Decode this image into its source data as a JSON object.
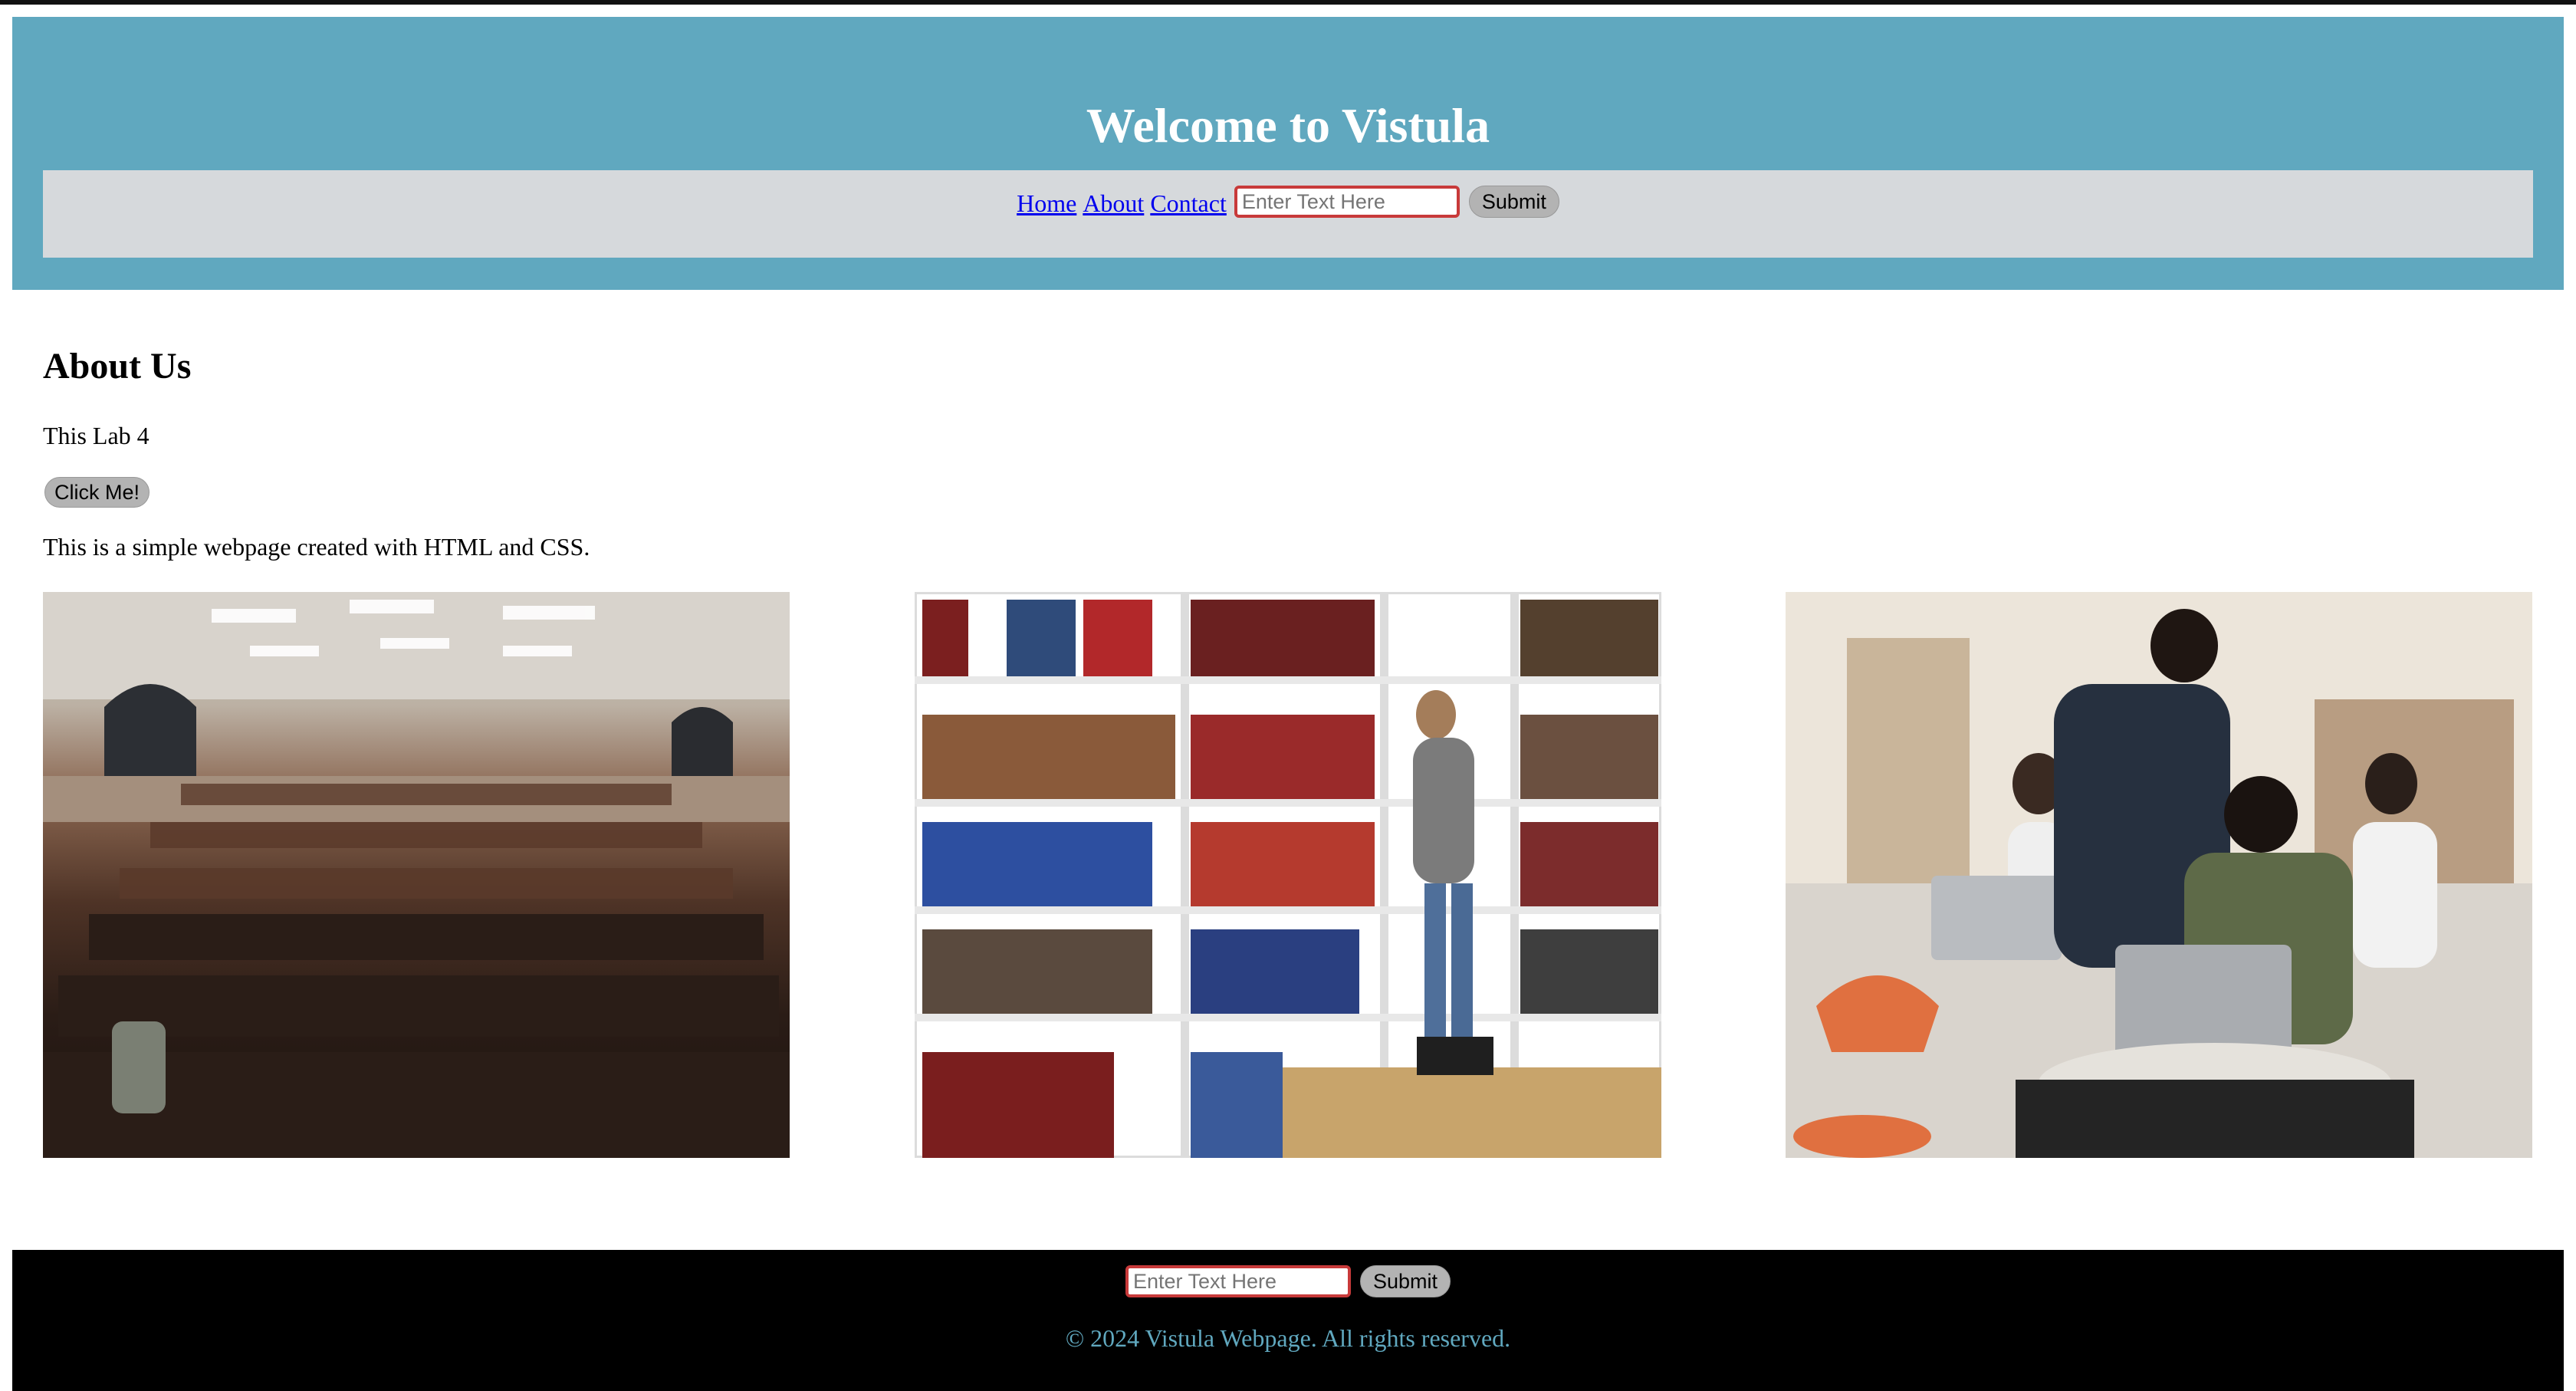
{
  "header": {
    "title": "Welcome to Vistula",
    "nav": {
      "home": "Home",
      "about": "About",
      "contact": "Contact"
    },
    "search": {
      "placeholder": "Enter Text Here",
      "value": ""
    },
    "submit_label": "Submit"
  },
  "main": {
    "heading": "About Us",
    "lab_text": "This Lab 4",
    "click_label": "Click Me!",
    "description": "This is a simple webpage created with HTML and CSS.",
    "images": [
      "lecture-hall-photo",
      "library-bookshelf-photo",
      "students-laptops-photo"
    ]
  },
  "footer": {
    "input_placeholder": "Enter Text Here",
    "submit_label": "Submit",
    "copyright": "© 2024 Vistula Webpage. All rights reserved."
  },
  "colors": {
    "header_bg": "#60a8bf",
    "nav_bg": "#d6d9dc",
    "footer_bg": "#000000",
    "footer_text": "#60a8bf",
    "input_border": "#c83a3a"
  }
}
